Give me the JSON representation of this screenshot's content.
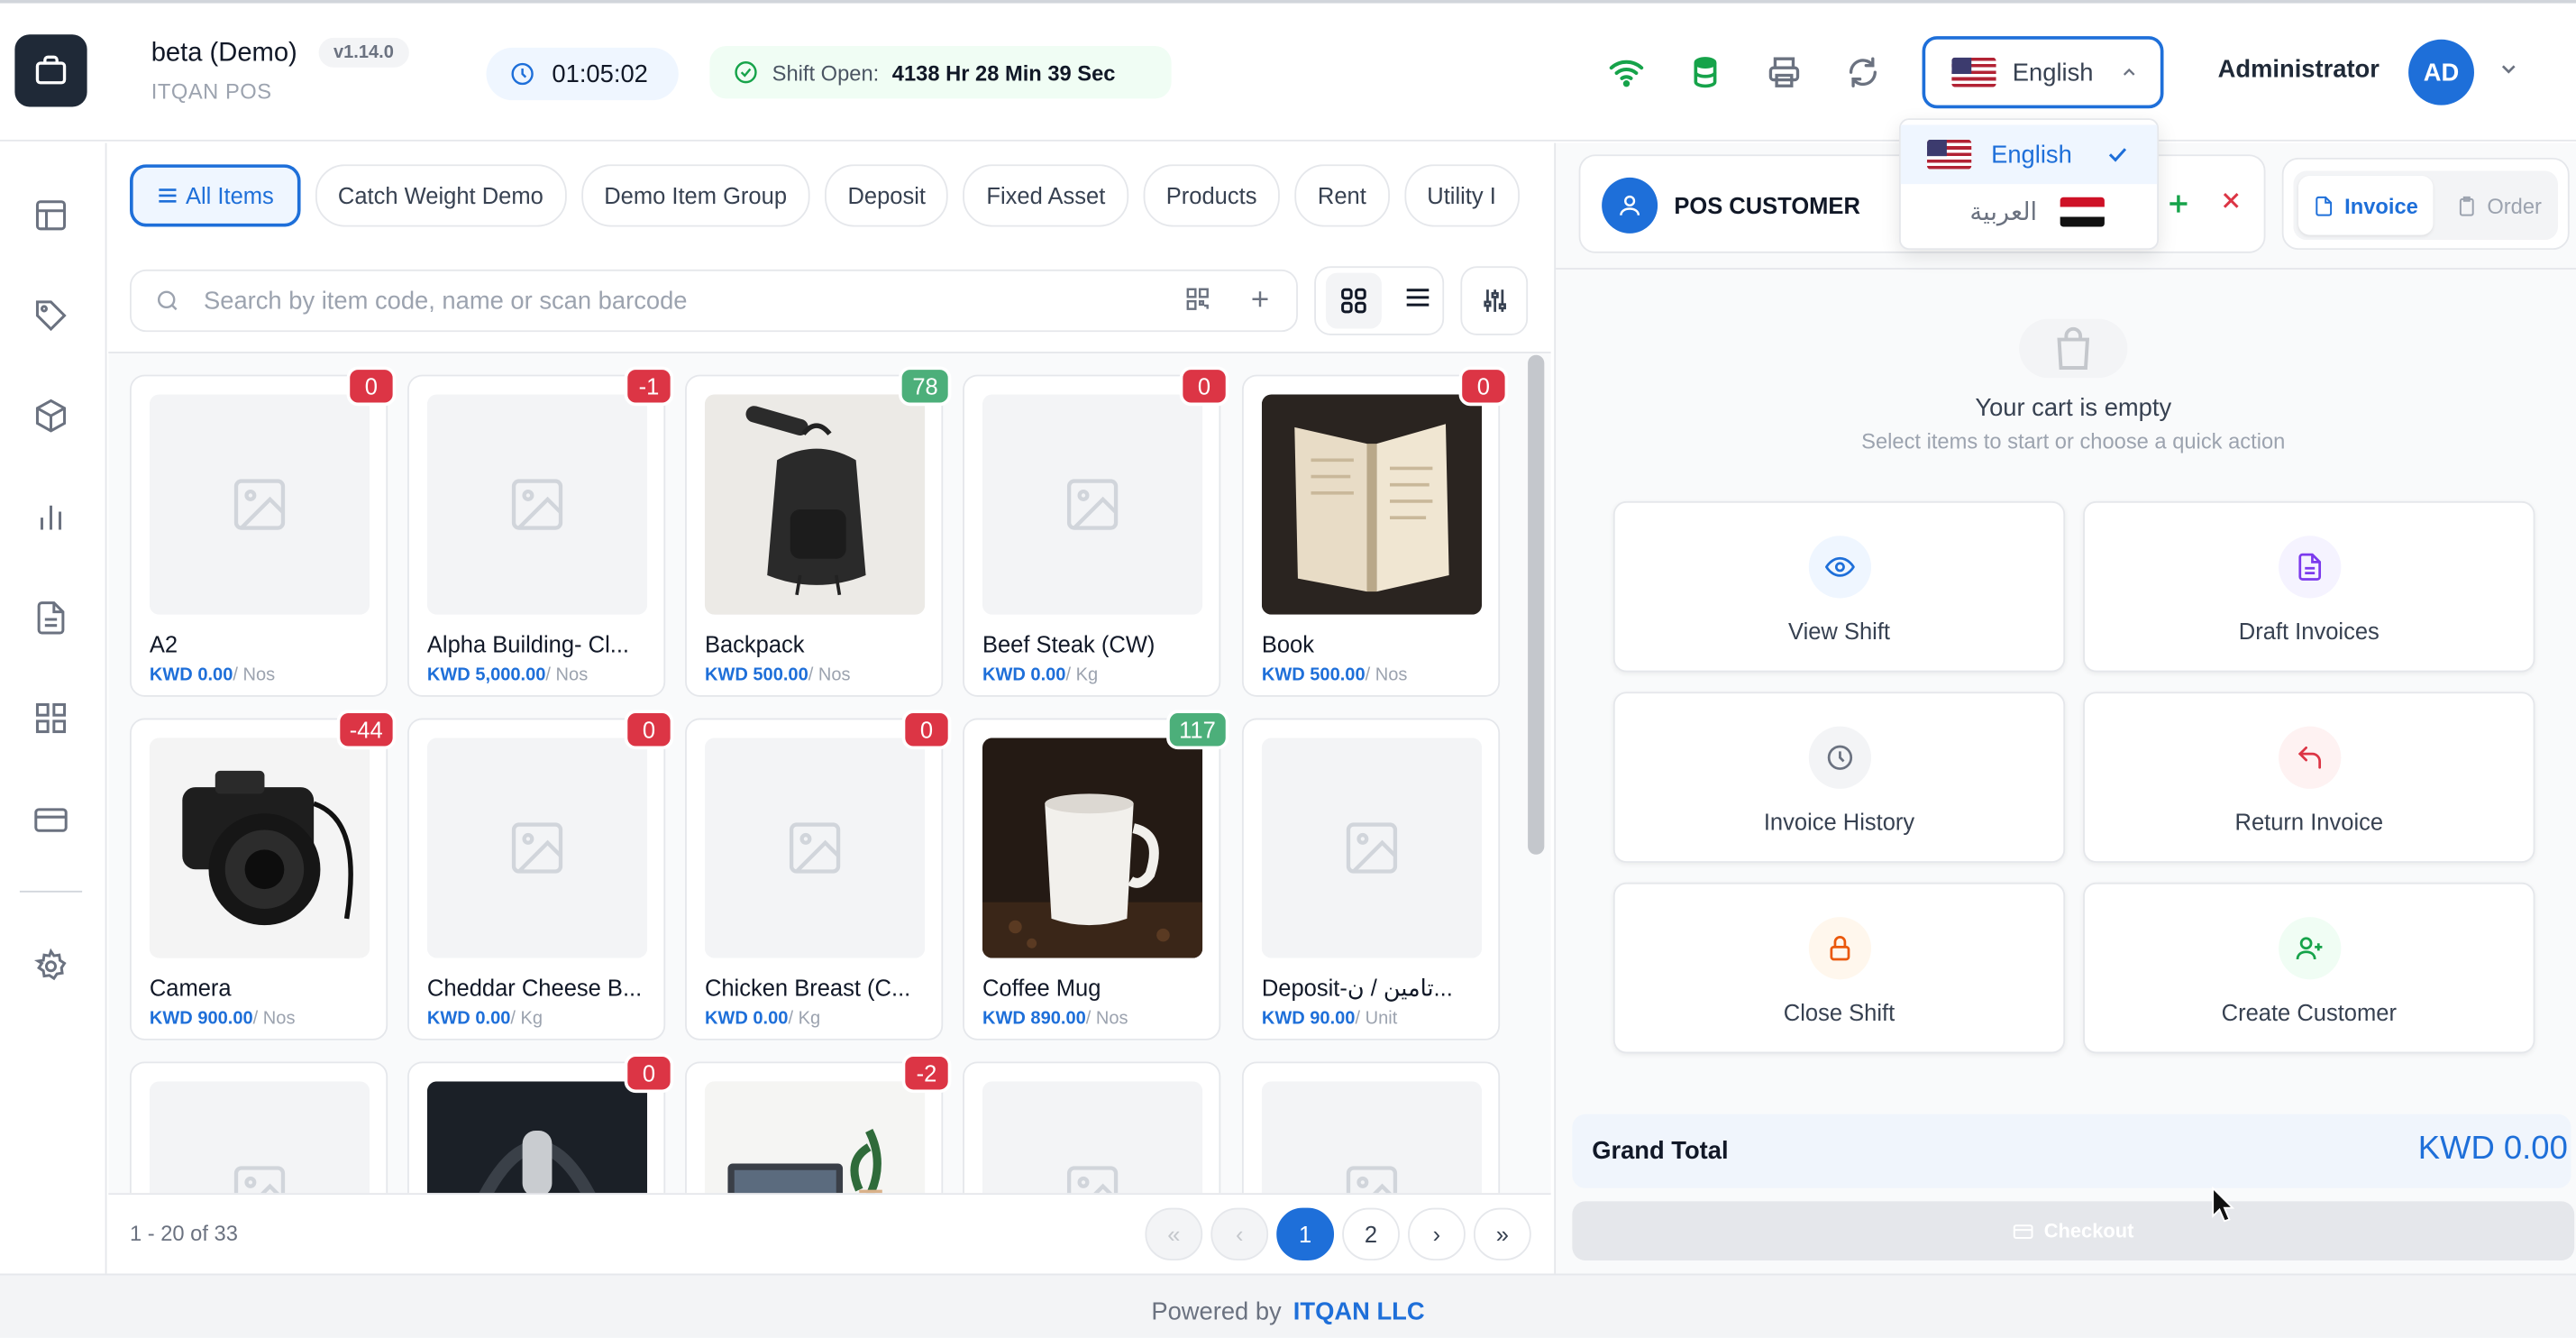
{
  "header": {
    "title": "beta (Demo)",
    "version": "v1.14.0",
    "subtitle": "ITQAN POS",
    "timer": "01:05:02",
    "shift_label": "Shift Open:",
    "shift_value": "4138 Hr 28 Min 39 Sec",
    "language": "English",
    "user_name": "Administrator",
    "user_initials": "AD"
  },
  "language_menu": {
    "options": [
      {
        "label": "English",
        "selected": true
      },
      {
        "label": "العربية",
        "selected": false
      }
    ]
  },
  "categories": [
    "All Items",
    "Catch Weight Demo",
    "Demo Item Group",
    "Deposit",
    "Fixed Asset",
    "Products",
    "Rent",
    "Utility I"
  ],
  "search": {
    "placeholder": "Search by item code, name or scan barcode"
  },
  "items": [
    {
      "name": "A2",
      "price": "KWD 0.00",
      "uom": "/ Nos",
      "stock": "0",
      "stock_status": "red",
      "image": "placeholder"
    },
    {
      "name": "Alpha Building- Cl...",
      "price": "KWD 5,000.00",
      "uom": "/ Nos",
      "stock": "-1",
      "stock_status": "red",
      "image": "placeholder"
    },
    {
      "name": "Backpack",
      "price": "KWD 500.00",
      "uom": "/ Nos",
      "stock": "78",
      "stock_status": "green",
      "image": "backpack"
    },
    {
      "name": "Beef Steak (CW)",
      "price": "KWD 0.00",
      "uom": "/ Kg",
      "stock": "0",
      "stock_status": "red",
      "image": "placeholder"
    },
    {
      "name": "Book",
      "price": "KWD 500.00",
      "uom": "/ Nos",
      "stock": "0",
      "stock_status": "red",
      "image": "book"
    },
    {
      "name": "Camera",
      "price": "KWD 900.00",
      "uom": "/ Nos",
      "stock": "-44",
      "stock_status": "red",
      "image": "camera"
    },
    {
      "name": "Cheddar Cheese B...",
      "price": "KWD 0.00",
      "uom": "/ Kg",
      "stock": "0",
      "stock_status": "red",
      "image": "placeholder"
    },
    {
      "name": "Chicken Breast (C...",
      "price": "KWD 0.00",
      "uom": "/ Kg",
      "stock": "0",
      "stock_status": "red",
      "image": "placeholder"
    },
    {
      "name": "Coffee Mug",
      "price": "KWD 890.00",
      "uom": "/ Nos",
      "stock": "117",
      "stock_status": "green",
      "image": "mug"
    },
    {
      "name": "Deposit-تامين / ن...",
      "price": "KWD 90.00",
      "uom": "/ Unit",
      "stock": "",
      "stock_status": "none",
      "image": "placeholder"
    },
    {
      "name": "",
      "price": "",
      "uom": "",
      "stock": "",
      "stock_status": "none",
      "image": "placeholder"
    },
    {
      "name": "",
      "price": "",
      "uom": "",
      "stock": "0",
      "stock_status": "red",
      "image": "headphones"
    },
    {
      "name": "",
      "price": "",
      "uom": "",
      "stock": "-2",
      "stock_status": "red",
      "image": "laptop"
    },
    {
      "name": "",
      "price": "",
      "uom": "",
      "stock": "",
      "stock_status": "none",
      "image": "placeholder"
    },
    {
      "name": "",
      "price": "",
      "uom": "",
      "stock": "",
      "stock_status": "none",
      "image": "placeholder"
    }
  ],
  "pagination": {
    "range": "1 - 20 of 33",
    "first": "«",
    "prev": "‹",
    "pages": [
      "1",
      "2"
    ],
    "current": "1",
    "next": "›",
    "last": "»"
  },
  "cart": {
    "customer": "POS CUSTOMER",
    "mode_invoice": "Invoice",
    "mode_order": "Order",
    "empty_title": "Your cart is empty",
    "empty_subtitle": "Select items to start or choose a quick action",
    "actions": [
      {
        "label": "View Shift",
        "icon": "eye-icon",
        "color": "#1e6fd9"
      },
      {
        "label": "Draft Invoices",
        "icon": "document-icon",
        "color": "#7c3aed"
      },
      {
        "label": "Invoice History",
        "icon": "clock-icon",
        "color": "#6b7280"
      },
      {
        "label": "Return Invoice",
        "icon": "return-arrow-icon",
        "color": "#dc3545"
      },
      {
        "label": "Close Shift",
        "icon": "lock-icon",
        "color": "#ea580c"
      },
      {
        "label": "Create Customer",
        "icon": "user-plus-icon",
        "color": "#16a34a"
      }
    ],
    "grand_total_label": "Grand Total",
    "grand_total_value": "KWD 0.00",
    "checkout_label": "Checkout"
  },
  "footer": {
    "powered_by": "Powered by",
    "company": "ITQAN LLC"
  },
  "colors": {
    "accent": "#1e6fd9",
    "danger": "#dc3545",
    "success": "#4caf7a"
  }
}
